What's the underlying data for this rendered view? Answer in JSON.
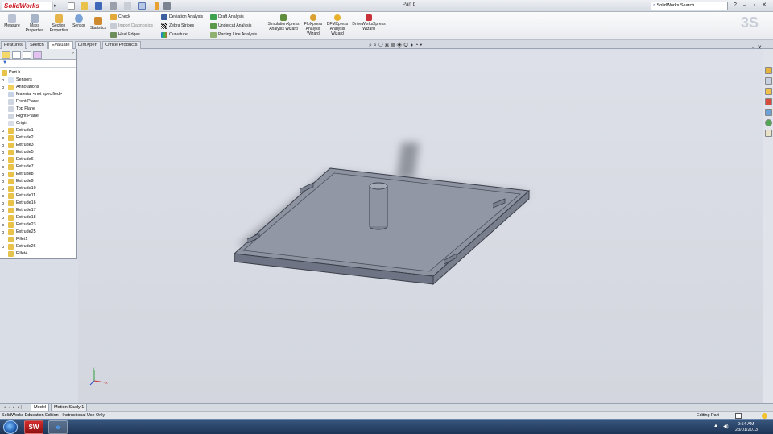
{
  "app": {
    "logo": "SolidWorks",
    "doc_title": "Part b",
    "search_placeholder": "SolidWorks Search"
  },
  "command_manager": {
    "big_buttons": [
      {
        "name": "measure-button",
        "label": "Measure"
      },
      {
        "name": "mass-properties-button",
        "label": "Mass Properties"
      },
      {
        "name": "section-properties-button",
        "label": "Section Properties"
      },
      {
        "name": "sensor-button",
        "label": "Sensor"
      },
      {
        "name": "statistics-button",
        "label": "Statistics"
      }
    ],
    "small_buttons": [
      {
        "name": "check-button",
        "label": "Check"
      },
      {
        "name": "import-diagnostics-button",
        "label": "Import Diagnostics"
      },
      {
        "name": "heal-edges-button",
        "label": "Heal Edges"
      },
      {
        "name": "deviation-analysis-button",
        "label": "Deviation Analysis"
      },
      {
        "name": "zebra-stripes-button",
        "label": "Zebra Stripes"
      },
      {
        "name": "curvature-button",
        "label": "Curvature"
      },
      {
        "name": "draft-analysis-button",
        "label": "Draft Analysis"
      },
      {
        "name": "undercut-analysis-button",
        "label": "Undercut Analysis"
      },
      {
        "name": "parting-line-analysis-button",
        "label": "Parting Line Analysis"
      }
    ],
    "wizards": [
      {
        "name": "simulationxpress-button",
        "label": "SimulationXpress Analysis Wizard"
      },
      {
        "name": "floxpress-button",
        "label": "FloXpress Analysis Wizard"
      },
      {
        "name": "dfmxpress-button",
        "label": "DFMXpress Analysis Wizard"
      },
      {
        "name": "driveworksxpress-button",
        "label": "DriveWorksXpress Wizard"
      }
    ]
  },
  "tabs": [
    "Features",
    "Sketch",
    "Evaluate",
    "DimXpert",
    "Office Products"
  ],
  "active_tab": "Evaluate",
  "feature_tree": {
    "root": "Part b",
    "items": [
      "Sensors",
      "Annotations",
      "Material <not specified>",
      "Front Plane",
      "Top Plane",
      "Right Plane",
      "Origin",
      "Extrude1",
      "Extrude2",
      "Extrude3",
      "Extrude5",
      "Extrude6",
      "Extrude7",
      "Extrude8",
      "Extrude9",
      "Extrude10",
      "Extrude11",
      "Extrude16",
      "Extrude17",
      "Extrude18",
      "Extrude23",
      "Extrude25",
      "Fillet1",
      "Extrude26",
      "Fillet4"
    ]
  },
  "bottom_tabs": [
    "Model",
    "Motion Study 1"
  ],
  "active_bottom_tab": "Model",
  "status": {
    "left": "SolidWorks Education Edition - Instructional Use Only",
    "mode": "Editing Part"
  },
  "taskbar": {
    "time": "9:54 AM",
    "date": "23/01/2013",
    "apps": [
      "SW",
      "e"
    ]
  },
  "colors": {
    "model_face": "#8e93a1",
    "model_side": "#6f7484",
    "brand_red": "#c8141e"
  }
}
